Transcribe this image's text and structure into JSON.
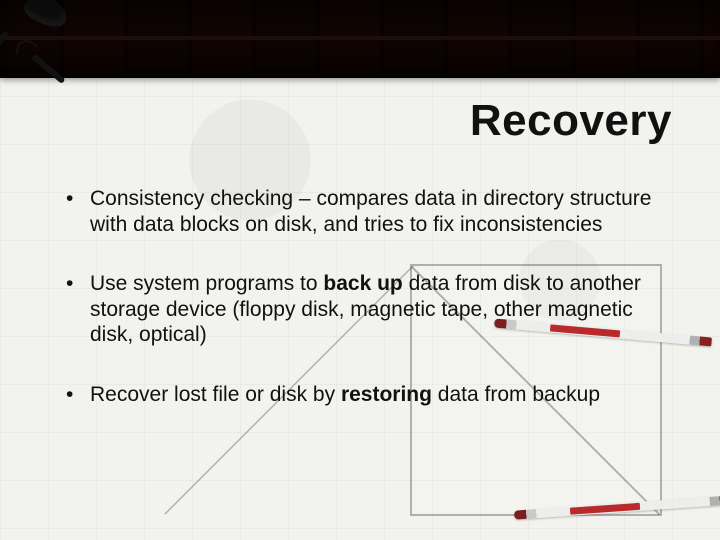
{
  "title": "Recovery",
  "bullets": [
    {
      "pre": "Consistency checking – compares data in directory structure with data blocks on disk, and tries to fix inconsistencies",
      "bold": "",
      "post": ""
    },
    {
      "pre": "Use system programs to ",
      "bold": "back up",
      "post": " data from disk to another storage device (floppy disk, magnetic tape, other magnetic disk, optical)"
    },
    {
      "pre": "Recover lost file or disk by ",
      "bold": "restoring",
      "post": " data from backup"
    }
  ]
}
